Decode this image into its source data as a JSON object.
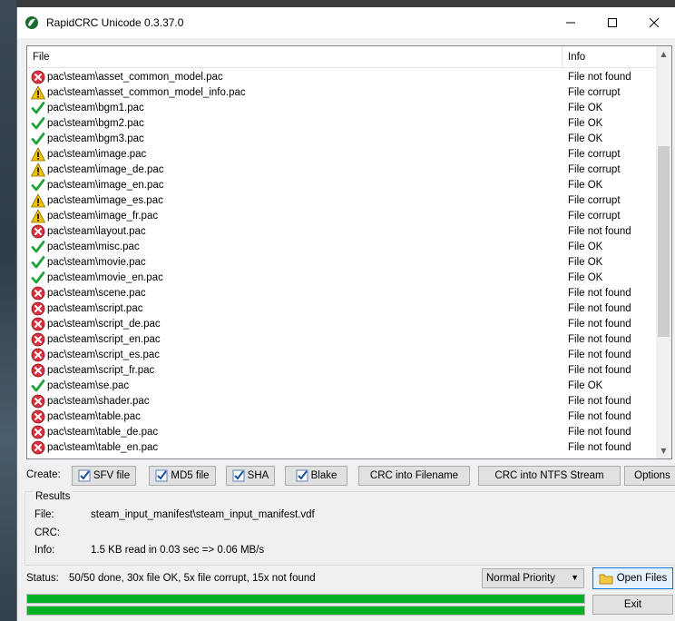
{
  "window": {
    "title": "RapidCRC Unicode 0.3.37.0",
    "controls": {
      "minimize": "─",
      "maximize": "☐",
      "close": "✕"
    }
  },
  "list": {
    "columns": {
      "file": "File",
      "info": "Info"
    },
    "rows": [
      {
        "file": "pac\\steam\\asset_common_model.pac",
        "info": "File not found",
        "status": "notfound"
      },
      {
        "file": "pac\\steam\\asset_common_model_info.pac",
        "info": "File corrupt",
        "status": "corrupt"
      },
      {
        "file": "pac\\steam\\bgm1.pac",
        "info": "File OK",
        "status": "ok"
      },
      {
        "file": "pac\\steam\\bgm2.pac",
        "info": "File OK",
        "status": "ok"
      },
      {
        "file": "pac\\steam\\bgm3.pac",
        "info": "File OK",
        "status": "ok"
      },
      {
        "file": "pac\\steam\\image.pac",
        "info": "File corrupt",
        "status": "corrupt"
      },
      {
        "file": "pac\\steam\\image_de.pac",
        "info": "File corrupt",
        "status": "corrupt"
      },
      {
        "file": "pac\\steam\\image_en.pac",
        "info": "File OK",
        "status": "ok"
      },
      {
        "file": "pac\\steam\\image_es.pac",
        "info": "File corrupt",
        "status": "corrupt"
      },
      {
        "file": "pac\\steam\\image_fr.pac",
        "info": "File corrupt",
        "status": "corrupt"
      },
      {
        "file": "pac\\steam\\layout.pac",
        "info": "File not found",
        "status": "notfound"
      },
      {
        "file": "pac\\steam\\misc.pac",
        "info": "File OK",
        "status": "ok"
      },
      {
        "file": "pac\\steam\\movie.pac",
        "info": "File OK",
        "status": "ok"
      },
      {
        "file": "pac\\steam\\movie_en.pac",
        "info": "File OK",
        "status": "ok"
      },
      {
        "file": "pac\\steam\\scene.pac",
        "info": "File not found",
        "status": "notfound"
      },
      {
        "file": "pac\\steam\\script.pac",
        "info": "File not found",
        "status": "notfound"
      },
      {
        "file": "pac\\steam\\script_de.pac",
        "info": "File not found",
        "status": "notfound"
      },
      {
        "file": "pac\\steam\\script_en.pac",
        "info": "File not found",
        "status": "notfound"
      },
      {
        "file": "pac\\steam\\script_es.pac",
        "info": "File not found",
        "status": "notfound"
      },
      {
        "file": "pac\\steam\\script_fr.pac",
        "info": "File not found",
        "status": "notfound"
      },
      {
        "file": "pac\\steam\\se.pac",
        "info": "File OK",
        "status": "ok"
      },
      {
        "file": "pac\\steam\\shader.pac",
        "info": "File not found",
        "status": "notfound"
      },
      {
        "file": "pac\\steam\\table.pac",
        "info": "File not found",
        "status": "notfound"
      },
      {
        "file": "pac\\steam\\table_de.pac",
        "info": "File not found",
        "status": "notfound"
      },
      {
        "file": "pac\\steam\\table_en.pac",
        "info": "File not found",
        "status": "notfound"
      }
    ]
  },
  "create": {
    "label": "Create:",
    "sfv": "SFV file",
    "md5": "MD5 file",
    "sha": "SHA",
    "blake": "Blake",
    "crc_filename": "CRC into Filename",
    "crc_ntfs": "CRC into NTFS Stream",
    "options": "Options"
  },
  "results": {
    "title": "Results",
    "file_label": "File:",
    "file_value": "steam_input_manifest\\steam_input_manifest.vdf",
    "crc_label": "CRC:",
    "crc_value": "",
    "info_label": "Info:",
    "info_value": "1.5 KB read in 0.03 sec => 0.06 MB/s"
  },
  "status": {
    "label": "Status:",
    "text": "50/50 done, 30x file OK, 5x file corrupt, 15x not found",
    "priority": "Normal Priority",
    "progress1": 1.0,
    "progress2": 1.0
  },
  "buttons": {
    "open_files": "Open Files",
    "exit": "Exit"
  },
  "colors": {
    "ok": "#1fa33a",
    "corrupt": "#f2c200",
    "notfound": "#d7313f",
    "progress": "#06b025"
  },
  "icons": {
    "ok": "check-icon",
    "corrupt": "warning-icon",
    "notfound": "error-icon"
  }
}
